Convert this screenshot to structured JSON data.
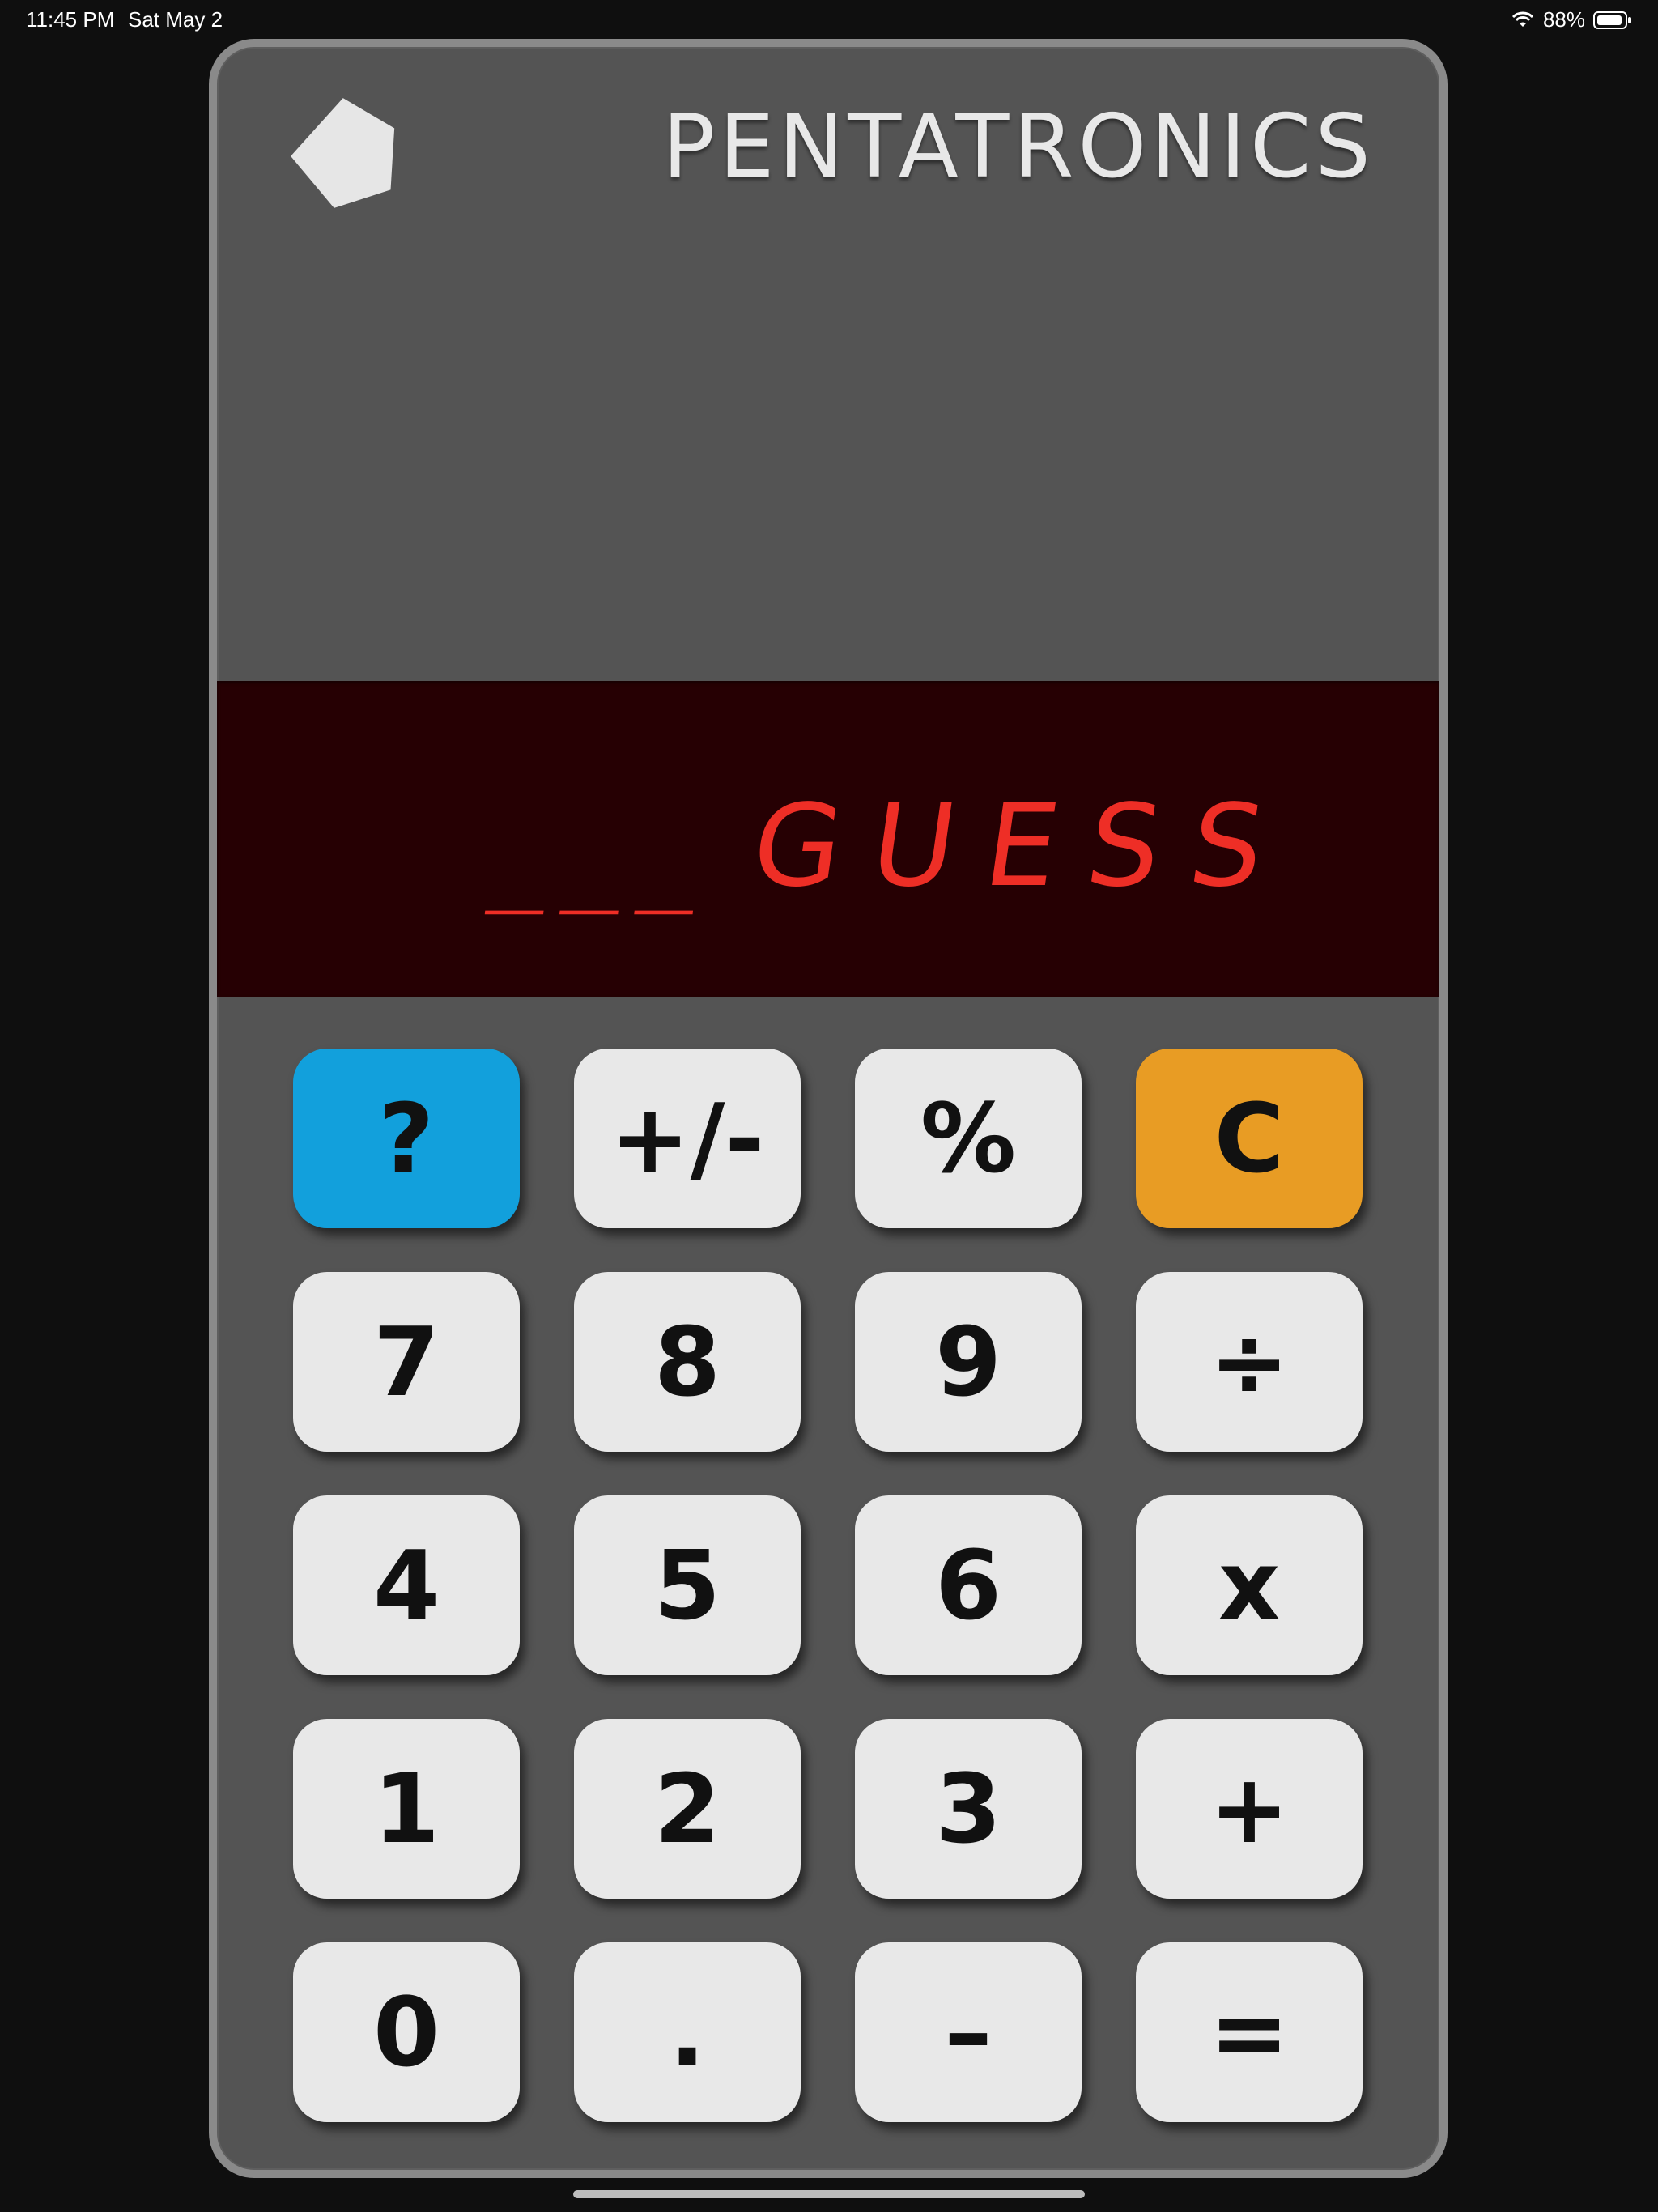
{
  "status_bar": {
    "time": "11:45 PM",
    "date": "Sat May 2",
    "battery": "88%",
    "wifi_icon": "wifi-icon",
    "battery_icon": "battery-icon"
  },
  "calculator": {
    "brand": "PENTATRONICS",
    "logo_icon": "pentagon-icon",
    "display": {
      "left_text": "___",
      "right_text": "GUESS",
      "digit_color": "#ee2e26",
      "background_color": "#260003"
    },
    "keys": [
      "?",
      "+/-",
      "%",
      "C",
      "7",
      "8",
      "9",
      "÷",
      "4",
      "5",
      "6",
      "x",
      "1",
      "2",
      "3",
      "+",
      "0",
      ".",
      "–",
      "="
    ],
    "colors": {
      "body": "#545454",
      "key": "#e8e8e8",
      "help_key": "#12a0dc",
      "clear_key": "#e89c24"
    }
  }
}
